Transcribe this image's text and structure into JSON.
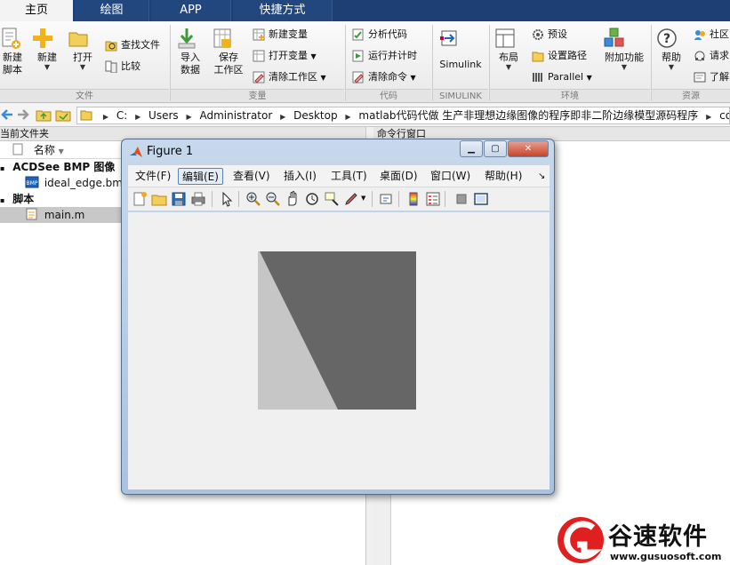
{
  "tabs": [
    {
      "label": "主页",
      "active": true
    },
    {
      "label": "绘图",
      "active": false
    },
    {
      "label": "APP",
      "active": false
    },
    {
      "label": "快捷方式",
      "active": false
    }
  ],
  "ribbon": {
    "file": {
      "new_script": "新建\n脚本",
      "new": "新建",
      "open": "打开",
      "find_files": "查找文件",
      "compare": "比较",
      "group_title": "文件"
    },
    "variable": {
      "import_data": "导入\n数据",
      "save_workspace": "保存\n工作区",
      "new_variable": "新建变量",
      "open_variable": "打开变量",
      "clear_workspace": "清除工作区",
      "group_title": "变量"
    },
    "code": {
      "analyze_code": "分析代码",
      "run_and_time": "运行并计时",
      "clear_commands": "清除命令",
      "group_title": "代码"
    },
    "simulink": {
      "label": "Simulink",
      "group_title": "SIMULINK"
    },
    "environment": {
      "layout": "布局",
      "preferences": "预设",
      "set_path": "设置路径",
      "parallel": "Parallel",
      "addons": "附加功能",
      "group_title": "环境"
    },
    "resources": {
      "help": "帮助",
      "community": "社区",
      "request": "请求",
      "learn": "了解",
      "group_title": "资源"
    }
  },
  "address": {
    "path": [
      "C:",
      "Users",
      "Administrator",
      "Desktop",
      "matlab代码代做 生产非理想边缘图像的程序即非二阶边缘模型源码程序",
      "code"
    ]
  },
  "current_folder": {
    "title": "当前文件夹",
    "column_name": "名称",
    "groups": [
      {
        "label": "ACDSee BMP 图像",
        "items": [
          "ideal_edge.bmp"
        ]
      },
      {
        "label": "脚本",
        "items": [
          "main.m"
        ]
      }
    ]
  },
  "command_window": {
    "title": "命令行窗口"
  },
  "figure": {
    "title": "Figure 1",
    "menu": [
      "文件(F)",
      "编辑(E)",
      "查看(V)",
      "插入(I)",
      "工具(T)",
      "桌面(D)",
      "窗口(W)",
      "帮助(H)"
    ],
    "highlighted_menu": "编辑(E)",
    "image": {
      "dark_color": "#666666",
      "light_color": "#c6c6c6"
    }
  },
  "watermark": {
    "brand": "谷速软件",
    "url": "www.gusuosoft.com",
    "color": "#e02020"
  },
  "colors": {
    "tabbar": "#1d3f73",
    "accent": "#2f5a96"
  }
}
